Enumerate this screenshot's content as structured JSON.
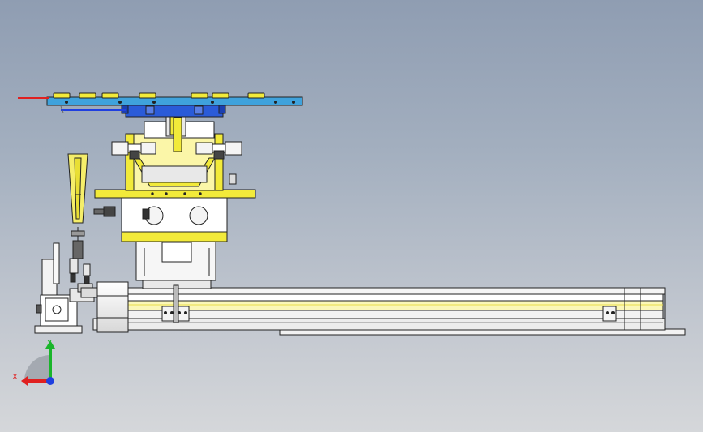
{
  "triad": {
    "x_label": "X",
    "y_label": "Y"
  },
  "colors": {
    "background_top": "#8f9db2",
    "background_bottom": "#d5d7da",
    "top_plate": "#3fa2dc",
    "bracket_blue": "#2a5bd8",
    "yellow": "#f2ea3a",
    "steel_white": "#f4f4f4",
    "outline": "#222222",
    "axis_x": "#e02020",
    "axis_y": "#19b52a",
    "axis_z": "#1f3fe0"
  }
}
